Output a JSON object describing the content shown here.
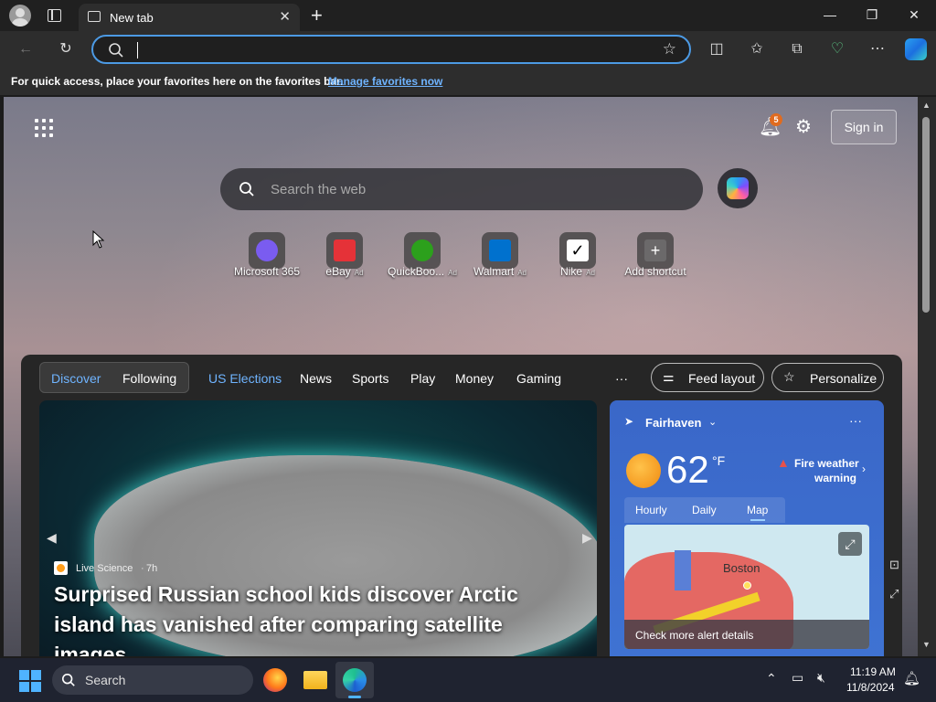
{
  "browser": {
    "tab_title": "New tab",
    "address_value": "",
    "favbar_message": "For quick access, place your favorites here on the favorites bar.",
    "favbar_link": "Manage favorites now"
  },
  "newtab": {
    "notification_count": "5",
    "sign_in": "Sign in",
    "search_placeholder": "Search the web",
    "shortcuts": [
      {
        "label": "Microsoft 365",
        "ad": "",
        "icon": "microsoft365-icon"
      },
      {
        "label": "eBay",
        "ad": "Ad",
        "icon": "ebay-icon"
      },
      {
        "label": "QuickBoo...",
        "ad": "Ad",
        "icon": "quickbooks-icon"
      },
      {
        "label": "Walmart",
        "ad": "Ad",
        "icon": "walmart-icon"
      },
      {
        "label": "Nike",
        "ad": "Ad",
        "icon": "nike-icon"
      },
      {
        "label": "Add shortcut",
        "ad": "",
        "icon": "plus-icon"
      }
    ],
    "feed_tabs": [
      "Discover",
      "Following"
    ],
    "feed_nav": [
      "US Elections",
      "News",
      "Sports",
      "Play",
      "Money",
      "Gaming"
    ],
    "more": "···",
    "feed_layout": "Feed layout",
    "personalize": "Personalize",
    "hero": {
      "source": "Live Science",
      "age": "7h",
      "headline": "Surprised Russian school kids discover Arctic island has vanished after comparing satellite images"
    },
    "weather": {
      "location": "Fairhaven",
      "temperature": "62",
      "unit": "°F",
      "alert_line1": "Fire weather",
      "alert_line2": "warning",
      "tabs": [
        "Hourly",
        "Daily",
        "Map"
      ],
      "active_tab": "Map",
      "map_city": "Boston",
      "alert_link": "Check more alert details"
    }
  },
  "taskbar": {
    "search_placeholder": "Search",
    "time": "11:19 AM",
    "date": "11/8/2024"
  },
  "colors": {
    "accent": "#4c9ae4",
    "link": "#6fb4ff",
    "weather_card": "#3f73d3",
    "alert_red": "#e8514a",
    "badge": "#e06b1f"
  }
}
